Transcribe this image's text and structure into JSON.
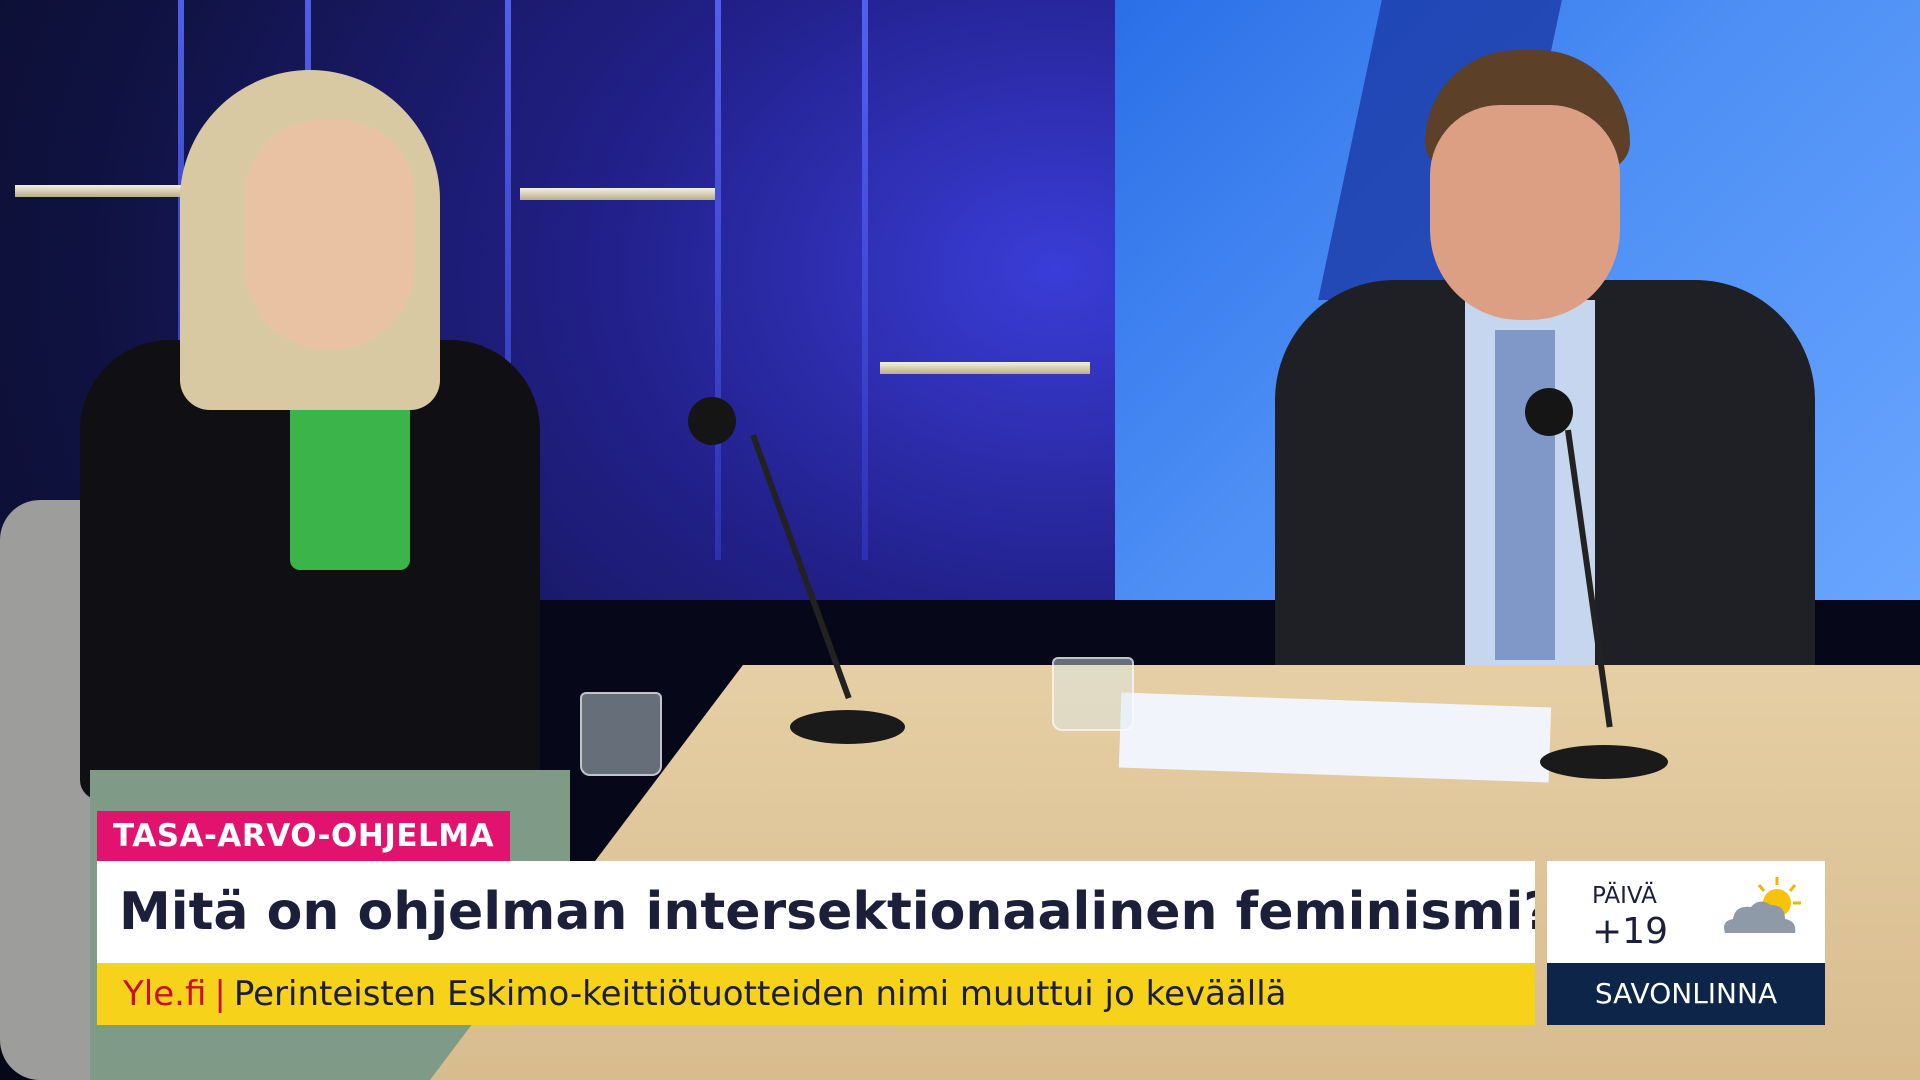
{
  "segment_tag": "TASA-ARVO-OHJELMA",
  "headline": "Mitä on ohjelman intersektionaalinen feminismi?",
  "ticker": {
    "source": "Yle.fi",
    "separator": "|",
    "text": "Perinteisten Eskimo-keittiötuotteiden nimi muuttui jo keväällä"
  },
  "weather": {
    "label": "PÄIVÄ",
    "temperature": "+19",
    "icon": "sun-behind-cloud-icon",
    "city": "SAVONLINNA"
  },
  "colors": {
    "tag_bg": "#e2136f",
    "headline_bg": "#ffffff",
    "ticker_bg": "#f7d21a",
    "city_bg": "#0d2548",
    "source_red": "#c8102e",
    "text_dark": "#1c1f3a"
  }
}
